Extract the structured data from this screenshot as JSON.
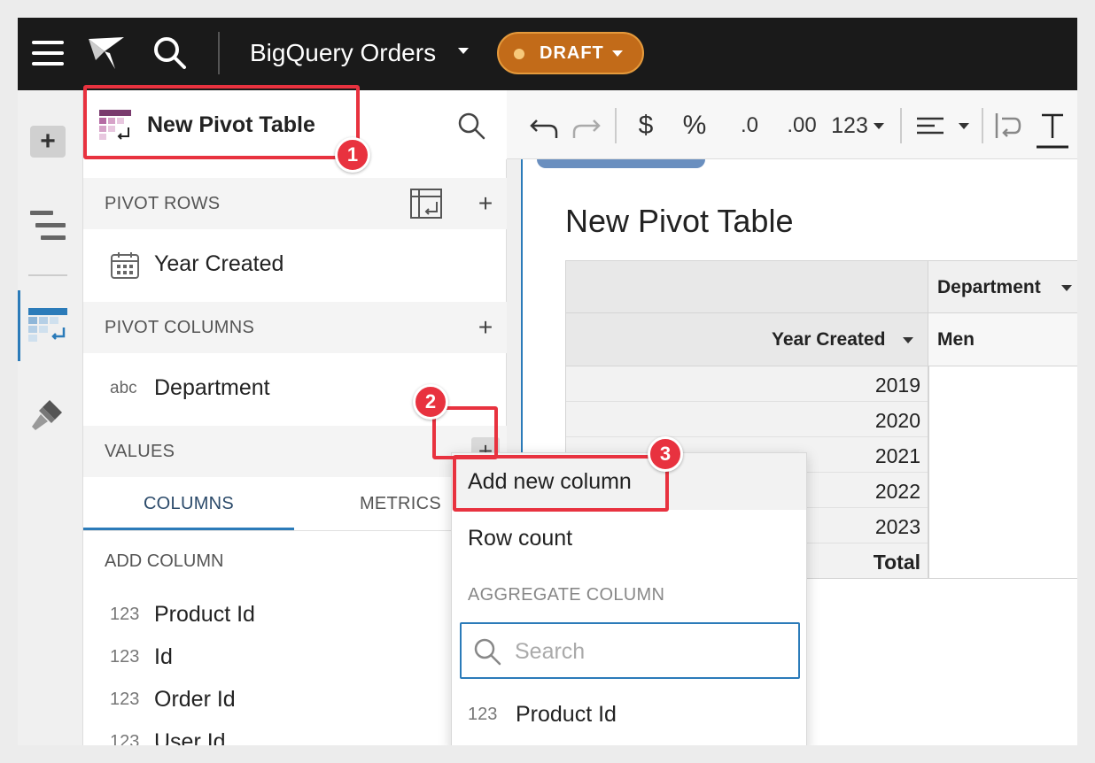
{
  "topbar": {
    "title": "BigQuery Orders",
    "status": "DRAFT",
    "accent": "#c26b19"
  },
  "panel": {
    "title": "New Pivot Table",
    "sections": {
      "pivot_rows": "PIVOT ROWS",
      "pivot_columns": "PIVOT COLUMNS",
      "values": "VALUES"
    },
    "pivot_rows_items": [
      {
        "icon": "calendar-icon",
        "label": "Year Created"
      }
    ],
    "pivot_columns_items": [
      {
        "type": "abc",
        "label": "Department"
      }
    ],
    "tabs": [
      "COLUMNS",
      "METRICS"
    ],
    "add_column_label": "ADD COLUMN",
    "columns": [
      {
        "type": "123",
        "label": "Product Id"
      },
      {
        "type": "123",
        "label": "Id"
      },
      {
        "type": "123",
        "label": "Order Id"
      },
      {
        "type": "123",
        "label": "User Id"
      }
    ]
  },
  "format_toolbar": {
    "currency": "$",
    "percent": "%",
    "decrease_decimals": ".0",
    "increase_decimals": ".00",
    "number_format": "123"
  },
  "pivot": {
    "title": "New Pivot Table",
    "column_header": "Department",
    "row_header": "Year Created",
    "column_value": "Men",
    "rows": [
      "2019",
      "2020",
      "2021",
      "2022",
      "2023"
    ],
    "total_label": "Total"
  },
  "menu": {
    "add_new_column": "Add new column",
    "row_count": "Row count",
    "aggregate_section": "AGGREGATE COLUMN",
    "search_placeholder": "Search",
    "first_column_type": "123",
    "first_column": "Product Id"
  },
  "callouts": [
    "1",
    "2",
    "3"
  ],
  "colors": {
    "highlight": "#e8323f",
    "active_blue": "#2b7bb9"
  }
}
